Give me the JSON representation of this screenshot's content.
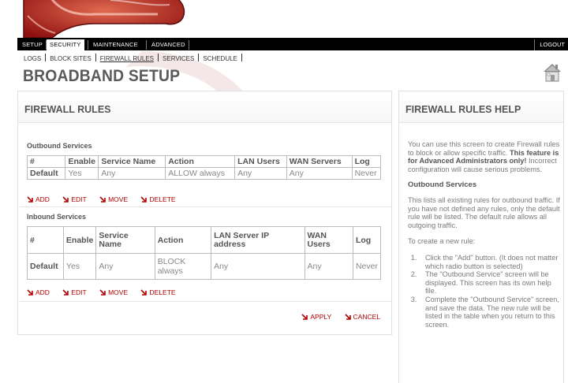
{
  "nav": {
    "tabs": [
      {
        "label": "SETUP"
      },
      {
        "label": "SECURITY"
      },
      {
        "label": "MAINTENANCE"
      },
      {
        "label": "ADVANCED"
      }
    ],
    "active_tab": "SECURITY",
    "logout": "LOGOUT"
  },
  "subnav": {
    "items": [
      {
        "label": "LOGS"
      },
      {
        "label": "BLOCK SITES"
      },
      {
        "label": "FIREWALL RULES"
      },
      {
        "label": "SERVICES"
      },
      {
        "label": "SCHEDULE"
      }
    ],
    "current": "FIREWALL RULES"
  },
  "page_title": "BROADBAND SETUP",
  "main": {
    "title": "FIREWALL RULES",
    "outbound": {
      "label": "Outbound Services",
      "headers": [
        "#",
        "Enable",
        "Service Name",
        "Action",
        "LAN Users",
        "WAN Servers",
        "Log"
      ],
      "row": [
        "Default",
        "Yes",
        "Any",
        "ALLOW always",
        "Any",
        "Any",
        "Never"
      ]
    },
    "inbound": {
      "label": "Inbound Services",
      "headers": [
        "#",
        "Enable",
        "Service Name",
        "Action",
        "LAN Server IP address",
        "WAN Users",
        "Log"
      ],
      "row": [
        "Default",
        "Yes",
        "Any",
        "BLOCK always",
        "Any",
        "Any",
        "Never"
      ]
    },
    "actions": {
      "add": "ADD",
      "edit": "EDIT",
      "move": "MOVE",
      "delete": "DELETE"
    },
    "apply": "APPLY",
    "cancel": "CANCEL"
  },
  "help": {
    "title": "FIREWALL RULES HELP",
    "intro_pre": "You can use this screen to create Firewall rules to block or allow specific traffic.",
    "intro_bold": "This feature is for Advanced Administrators only!",
    "intro_post": "Incorrect configuration will cause serious problems.",
    "outbound_heading": "Outbound Services",
    "outbound_text": "This lists all existing rules for outbound traffic. If you have not defined any rules, only the default rule will be listed. The default rule allows all outgoing traffic.",
    "create_text": "To create a new rule:",
    "steps": [
      "Click the \"Add\" button. (It does not matter which radio button is selected)",
      "The \"Outbound Service\" screen will be displayed. This screen has its own help file.",
      "Complete the \"Outbound Service\" screen, and save the data. The new rule will be listed in the table when you return to this screen."
    ]
  },
  "colors": {
    "nav_bg": "#000000",
    "accent_red": "#b00000",
    "logo_red": "#b21a1a",
    "text_grey": "#555555"
  },
  "icons": [
    "logo-graphic",
    "home-icon",
    "red-arrow-icon"
  ]
}
